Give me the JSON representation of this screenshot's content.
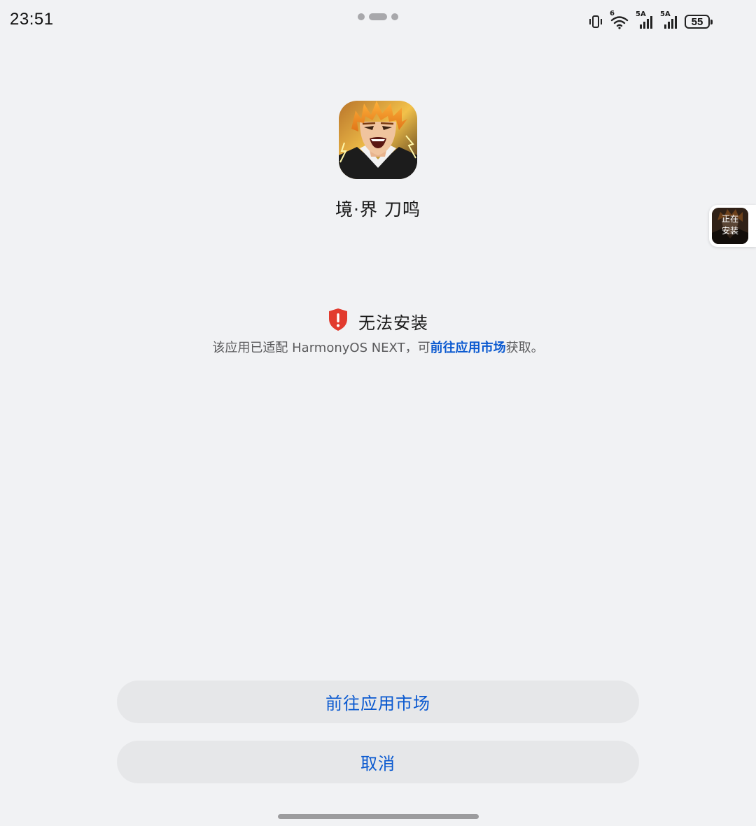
{
  "status_bar": {
    "time": "23:51",
    "net_label_1": "5A",
    "net_label_2": "5A",
    "wifi_label": "6",
    "battery": "55"
  },
  "app": {
    "name": "境·界 刀鸣"
  },
  "installing_badge": {
    "label": "正在\n安装"
  },
  "warning": {
    "title": "无法安装",
    "desc_prefix": "该应用已适配 HarmonyOS NEXT，可",
    "desc_link": "前往应用市场",
    "desc_suffix": "获取。",
    "color": "#e23b2e"
  },
  "buttons": {
    "market": "前往应用市场",
    "cancel": "取消"
  },
  "colors": {
    "accent": "#0a59d0",
    "background": "#f1f2f4",
    "button_bg": "#e6e7e9"
  }
}
